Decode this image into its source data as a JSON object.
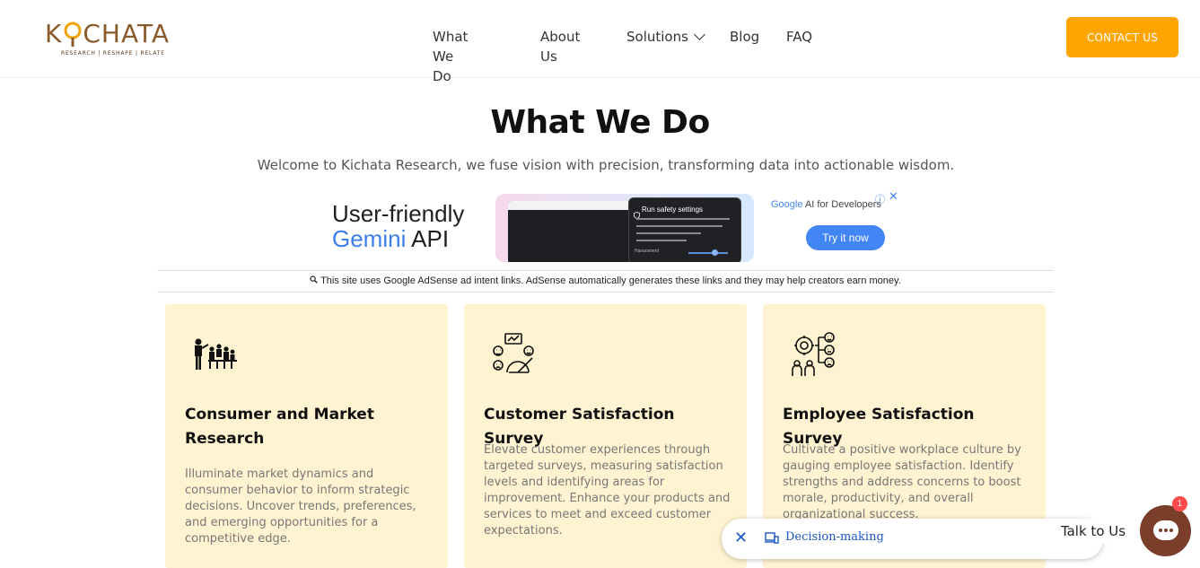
{
  "brand": {
    "logo_text_left": "K",
    "logo_text_right": "CHATA",
    "tagline": "RESEARCH | RESHAPE | RELATE",
    "color": "#8a5a2b"
  },
  "nav": {
    "items": [
      "What We Do",
      "About Us",
      "Solutions",
      "Blog",
      "FAQ"
    ],
    "contact_label": "CONTACT US",
    "accent": "#ffa500"
  },
  "hero": {
    "title": "What We Do",
    "subtitle": "Welcome to Kichata Research, we fuse vision with precision, transforming data into actionable wisdom."
  },
  "ad": {
    "headline_line1": "User-friendly",
    "headline_line2_blue": "Gemini",
    "headline_line2_rest": " API",
    "panel_title": "Run safety settings",
    "panel_label": "Harassment",
    "brand_google": "Google",
    "brand_rest": " AI for Developers",
    "cta": "Try it now",
    "info_icon": "info-icon",
    "close_icon": "close-icon"
  },
  "adsense_notice": "This site uses Google AdSense ad intent links. AdSense automatically generates these links and they may help creators earn money.",
  "cards": [
    {
      "icon": "people-presentation-icon",
      "title": "Consumer and Market Research",
      "body": "Illuminate market dynamics and consumer behavior to inform strategic decisions. Uncover trends, preferences, and emerging opportunities for a competitive edge."
    },
    {
      "icon": "satisfaction-gauge-icon",
      "title": "Customer Satisfaction Survey",
      "body": "Elevate customer experiences through targeted surveys, measuring satisfaction levels and identifying areas for improvement. Enhance your products and services to meet and exceed customer expectations."
    },
    {
      "icon": "employee-feedback-icon",
      "title": "Employee Satisfaction Survey",
      "body": "Cultivate a positive workplace culture by gauging employee satisfaction. Identify strengths and address concerns to boost morale, productivity, and overall organizational success."
    }
  ],
  "floating": {
    "pill_label": "Decision-making",
    "talk_label": "Talk to Us",
    "badge_count": "1"
  }
}
